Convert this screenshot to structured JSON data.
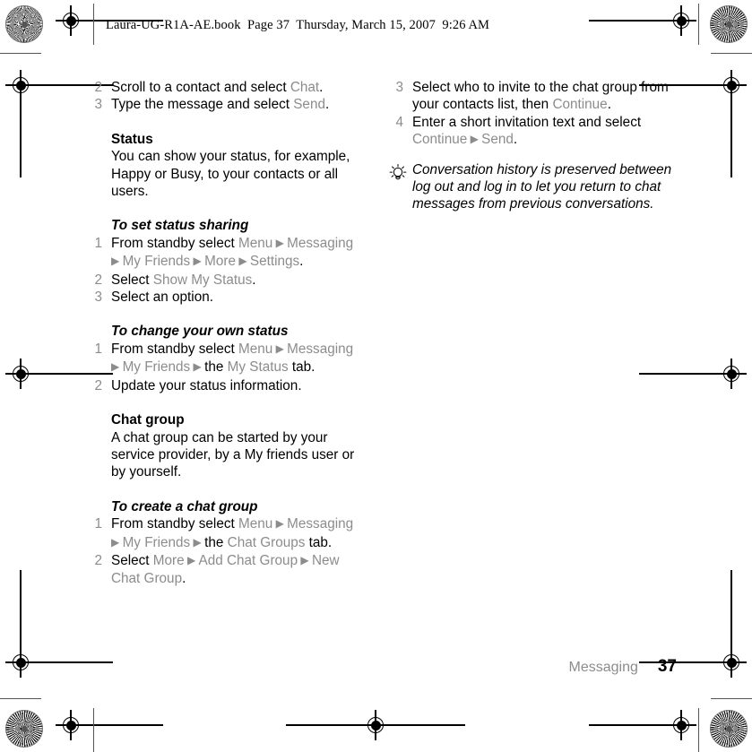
{
  "page": {
    "running_header": "Laura-UG-R1A-AE.book  Page 37  Thursday, March 15, 2007  9:26 AM",
    "footer_chapter": "Messaging",
    "footer_page_number": "37",
    "ui_term_color": "#8c8c8c",
    "body_text_color": "#000000",
    "background_color": "#ffffff"
  },
  "left_column": {
    "steps_chat": [
      {
        "num": "2",
        "before": "Scroll to a contact and select ",
        "ui": "Chat",
        "after": "."
      },
      {
        "num": "3",
        "before": "Type the message and select ",
        "ui": "Send",
        "after": "."
      }
    ],
    "status_section": {
      "heading": "Status",
      "body": "You can show your status, for example, Happy or Busy, to your contacts or all users."
    },
    "task_status_sharing": {
      "heading": "To set status sharing",
      "steps": [
        {
          "num": "1",
          "segments": [
            {
              "text": "From standby select ",
              "style": "body"
            },
            {
              "text": "Menu",
              "style": "ui"
            },
            {
              "text": " ▶ ",
              "style": "arrow"
            },
            {
              "text": "Messaging",
              "style": "ui"
            },
            {
              "text": " ▶ ",
              "style": "arrow"
            },
            {
              "text": "My Friends",
              "style": "ui"
            },
            {
              "text": " ▶ ",
              "style": "arrow"
            },
            {
              "text": "More",
              "style": "ui"
            },
            {
              "text": " ▶ ",
              "style": "arrow"
            },
            {
              "text": "Settings",
              "style": "ui"
            },
            {
              "text": ".",
              "style": "body"
            }
          ]
        },
        {
          "num": "2",
          "segments": [
            {
              "text": "Select ",
              "style": "body"
            },
            {
              "text": "Show My Status",
              "style": "ui"
            },
            {
              "text": ".",
              "style": "body"
            }
          ]
        },
        {
          "num": "3",
          "segments": [
            {
              "text": "Select an option.",
              "style": "body"
            }
          ]
        }
      ]
    },
    "task_change_status": {
      "heading": "To change your own status",
      "steps": [
        {
          "num": "1",
          "segments": [
            {
              "text": "From standby select ",
              "style": "body"
            },
            {
              "text": "Menu",
              "style": "ui"
            },
            {
              "text": " ▶ ",
              "style": "arrow"
            },
            {
              "text": "Messaging",
              "style": "ui"
            },
            {
              "text": " ▶ ",
              "style": "arrow"
            },
            {
              "text": "My Friends",
              "style": "ui"
            },
            {
              "text": " ▶ ",
              "style": "arrow"
            },
            {
              "text": "the ",
              "style": "body"
            },
            {
              "text": "My Status",
              "style": "ui"
            },
            {
              "text": " tab.",
              "style": "body"
            }
          ]
        },
        {
          "num": "2",
          "segments": [
            {
              "text": "Update your status information.",
              "style": "body"
            }
          ]
        }
      ]
    },
    "chat_group_section": {
      "heading": "Chat group",
      "body": "A chat group can be started by your service provider, by a My friends user or by yourself."
    },
    "task_create_chat_group": {
      "heading": "To create a chat group",
      "steps": [
        {
          "num": "1",
          "segments": [
            {
              "text": "From standby select ",
              "style": "body"
            },
            {
              "text": "Menu",
              "style": "ui"
            },
            {
              "text": " ▶ ",
              "style": "arrow"
            },
            {
              "text": "Messaging",
              "style": "ui"
            },
            {
              "text": " ▶ ",
              "style": "arrow"
            },
            {
              "text": "My Friends",
              "style": "ui"
            },
            {
              "text": " ▶ ",
              "style": "arrow"
            },
            {
              "text": "the ",
              "style": "body"
            },
            {
              "text": "Chat Groups",
              "style": "ui"
            },
            {
              "text": " tab.",
              "style": "body"
            }
          ]
        },
        {
          "num": "2",
          "segments": [
            {
              "text": "Select ",
              "style": "body"
            },
            {
              "text": "More",
              "style": "ui"
            },
            {
              "text": " ▶ ",
              "style": "arrow"
            },
            {
              "text": "Add Chat Group",
              "style": "ui"
            },
            {
              "text": " ▶ ",
              "style": "arrow"
            },
            {
              "text": "New Chat Group",
              "style": "ui"
            },
            {
              "text": ".",
              "style": "body"
            }
          ]
        }
      ]
    }
  },
  "right_column": {
    "steps_continued": [
      {
        "num": "3",
        "segments": [
          {
            "text": "Select who to invite to the chat group from your contacts list, then ",
            "style": "body"
          },
          {
            "text": "Continue",
            "style": "ui"
          },
          {
            "text": ".",
            "style": "body"
          }
        ]
      },
      {
        "num": "4",
        "segments": [
          {
            "text": "Enter a short invitation text and select ",
            "style": "body"
          },
          {
            "text": "Continue",
            "style": "ui"
          },
          {
            "text": " ▶ ",
            "style": "arrow"
          },
          {
            "text": "Send",
            "style": "ui"
          },
          {
            "text": ".",
            "style": "body"
          }
        ]
      }
    ],
    "tip": {
      "icon": "lightbulb-icon",
      "text": "Conversation history is preserved between log out and log in to let you return to chat messages from previous conversations."
    }
  }
}
